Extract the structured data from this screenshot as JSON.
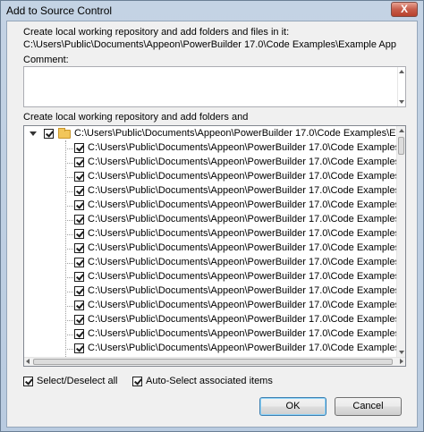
{
  "window": {
    "title": "Add to Source Control",
    "close_glyph": "X"
  },
  "intro": {
    "line1": "Create local working repository and add folders and files in it:",
    "path": "C:\\Users\\Public\\Documents\\Appeon\\PowerBuilder 17.0\\Code Examples\\Example App"
  },
  "comment": {
    "label": "Comment:",
    "value": ""
  },
  "tree": {
    "label": "Create local working repository and add folders and",
    "root": {
      "text": "C:\\Users\\Public\\Documents\\Appeon\\PowerBuilder 17.0\\Code Examples\\Example App",
      "checked": true,
      "expanded": true
    },
    "items": [
      "C:\\Users\\Public\\Documents\\Appeon\\PowerBuilder 17.0\\Code Examples\\Example App\\",
      "C:\\Users\\Public\\Documents\\Appeon\\PowerBuilder 17.0\\Code Examples\\Example App\\",
      "C:\\Users\\Public\\Documents\\Appeon\\PowerBuilder 17.0\\Code Examples\\Example App\\",
      "C:\\Users\\Public\\Documents\\Appeon\\PowerBuilder 17.0\\Code Examples\\Example App\\",
      "C:\\Users\\Public\\Documents\\Appeon\\PowerBuilder 17.0\\Code Examples\\Example App\\",
      "C:\\Users\\Public\\Documents\\Appeon\\PowerBuilder 17.0\\Code Examples\\Example App\\",
      "C:\\Users\\Public\\Documents\\Appeon\\PowerBuilder 17.0\\Code Examples\\Example App\\",
      "C:\\Users\\Public\\Documents\\Appeon\\PowerBuilder 17.0\\Code Examples\\Example App\\",
      "C:\\Users\\Public\\Documents\\Appeon\\PowerBuilder 17.0\\Code Examples\\Example App\\",
      "C:\\Users\\Public\\Documents\\Appeon\\PowerBuilder 17.0\\Code Examples\\Example App\\",
      "C:\\Users\\Public\\Documents\\Appeon\\PowerBuilder 17.0\\Code Examples\\Example App\\",
      "C:\\Users\\Public\\Documents\\Appeon\\PowerBuilder 17.0\\Code Examples\\Example App\\",
      "C:\\Users\\Public\\Documents\\Appeon\\PowerBuilder 17.0\\Code Examples\\Example App\\",
      "C:\\Users\\Public\\Documents\\Appeon\\PowerBuilder 17.0\\Code Examples\\Example App\\",
      "C:\\Users\\Public\\Documents\\Appeon\\PowerBuilder 17.0\\Code Examples\\Example App\\"
    ]
  },
  "options": {
    "select_all": {
      "label": "Select/Deselect all",
      "checked": true
    },
    "auto_select": {
      "label": "Auto-Select associated items",
      "checked": true
    }
  },
  "buttons": {
    "ok": "OK",
    "cancel": "Cancel"
  }
}
